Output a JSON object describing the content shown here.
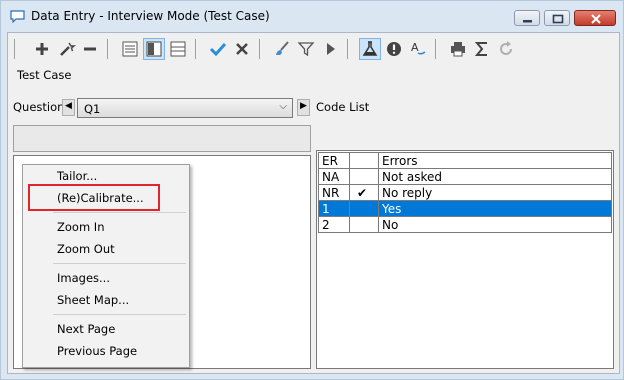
{
  "window": {
    "title": "Data Entry - Interview Mode (Test Case)",
    "icon": "speech-bubble-icon",
    "controls": [
      "minimize-icon",
      "restore-icon",
      "close-icon"
    ]
  },
  "toolbar": {
    "buttons": [
      {
        "name": "add",
        "icon": "plus-icon"
      },
      {
        "name": "edit",
        "icon": "wand-icon"
      },
      {
        "name": "remove",
        "icon": "minus-icon"
      },
      {
        "name": "form-view",
        "icon": "form-icon"
      },
      {
        "name": "split-view",
        "icon": "split-view-icon",
        "active": true
      },
      {
        "name": "list-view",
        "icon": "list-icon"
      },
      {
        "name": "accept",
        "icon": "check-icon"
      },
      {
        "name": "cancel",
        "icon": "x-icon"
      },
      {
        "name": "clean",
        "icon": "brush-icon"
      },
      {
        "name": "filter",
        "icon": "filter-icon"
      },
      {
        "name": "run",
        "icon": "play-icon"
      },
      {
        "name": "test",
        "icon": "flask-icon",
        "active": true
      },
      {
        "name": "errors",
        "icon": "exclamation-icon"
      },
      {
        "name": "spell-check",
        "icon": "spell-check-icon"
      },
      {
        "name": "print",
        "icon": "printer-icon"
      },
      {
        "name": "sum",
        "icon": "sigma-icon"
      },
      {
        "name": "refresh",
        "icon": "refresh-icon"
      }
    ],
    "accent_color": "#2a8fd6"
  },
  "test_case_label": "Test Case",
  "question": {
    "label": "Question",
    "value": "Q1"
  },
  "code_list": {
    "label": "Code List",
    "rows": [
      {
        "code": "ER",
        "mark": "",
        "text": "Errors",
        "selected": false
      },
      {
        "code": "NA",
        "mark": "",
        "text": "Not asked",
        "selected": false
      },
      {
        "code": "NR",
        "mark": "✔",
        "text": "No reply",
        "selected": false
      },
      {
        "code": "1",
        "mark": "",
        "text": "Yes",
        "selected": true
      },
      {
        "code": "2",
        "mark": "",
        "text": "No",
        "selected": false
      }
    ],
    "selection_color": "#0078d7"
  },
  "context_menu": {
    "items": [
      {
        "label": "Tailor..."
      },
      {
        "label": "(Re)Calibrate...",
        "highlighted": true
      },
      {
        "label": "Zoom In"
      },
      {
        "label": "Zoom Out"
      },
      {
        "label": "Images..."
      },
      {
        "label": "Sheet Map..."
      },
      {
        "label": "Next Page"
      },
      {
        "label": "Previous Page"
      }
    ],
    "highlight_color": "#e0252c"
  }
}
